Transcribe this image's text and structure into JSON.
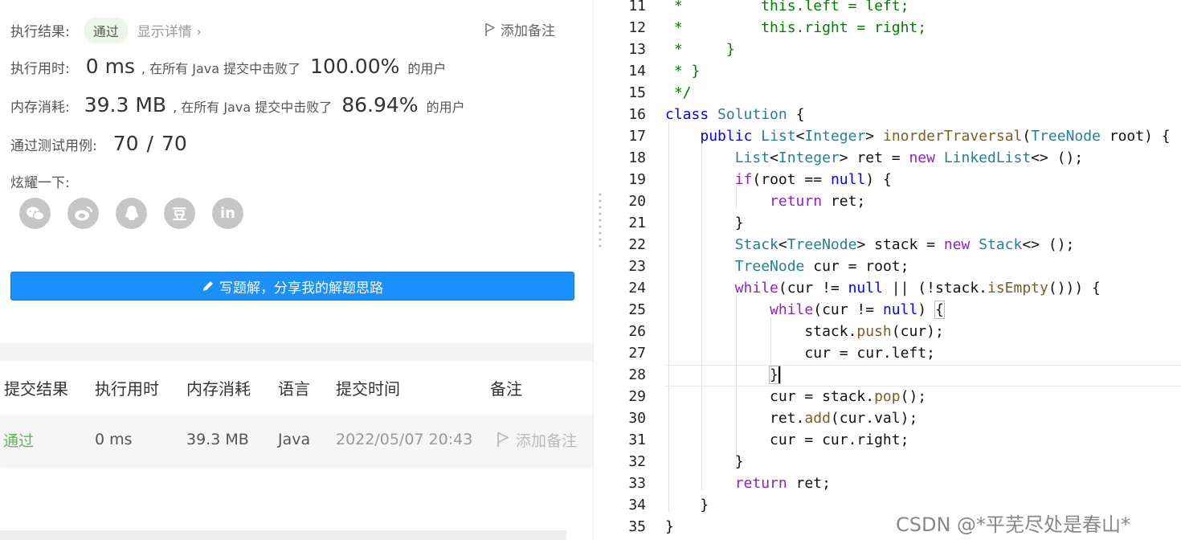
{
  "result": {
    "label": "执行结果:",
    "status": "通过",
    "details": "显示详情 ›",
    "add_note": "添加备注"
  },
  "runtime": {
    "label": "执行用时:",
    "value": "0 ms",
    "mid": ", 在所有 Java 提交中击败了",
    "percent": "100.00%",
    "tail": "的用户"
  },
  "memory": {
    "label": "内存消耗:",
    "value": "39.3 MB",
    "mid": ", 在所有 Java 提交中击败了",
    "percent": "86.94%",
    "tail": "的用户"
  },
  "tests": {
    "label": "通过测试用例:",
    "passed": "70",
    "sep": "/",
    "total": "70"
  },
  "share": {
    "label": "炫耀一下:",
    "icons": [
      "wechat-icon",
      "weibo-icon",
      "qq-icon",
      "douban-icon",
      "linkedin-icon"
    ],
    "douban_glyph": "豆",
    "linkedin_glyph": "in"
  },
  "write_solution": "写题解，分享我的解题思路",
  "table": {
    "headers": [
      "提交结果",
      "执行用时",
      "内存消耗",
      "语言",
      "提交时间",
      "备注"
    ],
    "row": {
      "result": "通过",
      "time": "0 ms",
      "memory": "39.3 MB",
      "language": "Java",
      "submitted": "2022/05/07 20:43",
      "note": "添加备注"
    }
  },
  "code": {
    "line_numbers": [
      "11",
      "12",
      "13",
      "14",
      "15",
      "16",
      "17",
      "18",
      "19",
      "20",
      "21",
      "22",
      "23",
      "24",
      "25",
      "26",
      "27",
      "28",
      "29",
      "30",
      "31",
      "32",
      "33",
      "34",
      "35"
    ]
  },
  "watermark": "CSDN @*平芜尽处是春山*",
  "colors": {
    "accent": "#1a90ff",
    "pass_green": "#5cb85c",
    "keyword": "#8f1fc9",
    "type": "#267f99",
    "comment": "#008000"
  }
}
